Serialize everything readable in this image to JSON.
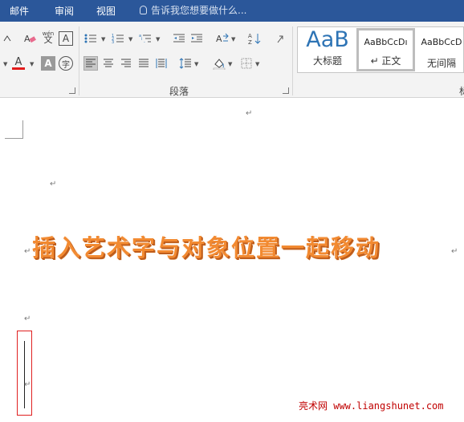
{
  "menu": {
    "tabs": [
      "邮件",
      "审阅",
      "视图"
    ],
    "search_placeholder": "告诉我您想要做什么..."
  },
  "ribbon": {
    "paragraph_group_label": "段落",
    "styles": [
      {
        "sample": "AaB",
        "name": "大标题"
      },
      {
        "sample": "AaBbCcDı",
        "name": "↵ 正文"
      },
      {
        "sample": "AaBbCcD",
        "name": "无间隔"
      }
    ],
    "partial_label": "标"
  },
  "document": {
    "paragraph_mark": "↵",
    "wordart_text": "插入艺术字与对象位置一起移动",
    "watermark": "亮术网 www.liangshunet.com"
  },
  "colors": {
    "menu_bar": "#2b579a",
    "ribbon_bg": "#f3f3f3",
    "wordart_fill": "#f28a31",
    "font_color_underline": "#e31b1b",
    "selection_border": "#e02020",
    "watermark": "#c00000",
    "style_sample_blue": "#2e74b5"
  }
}
